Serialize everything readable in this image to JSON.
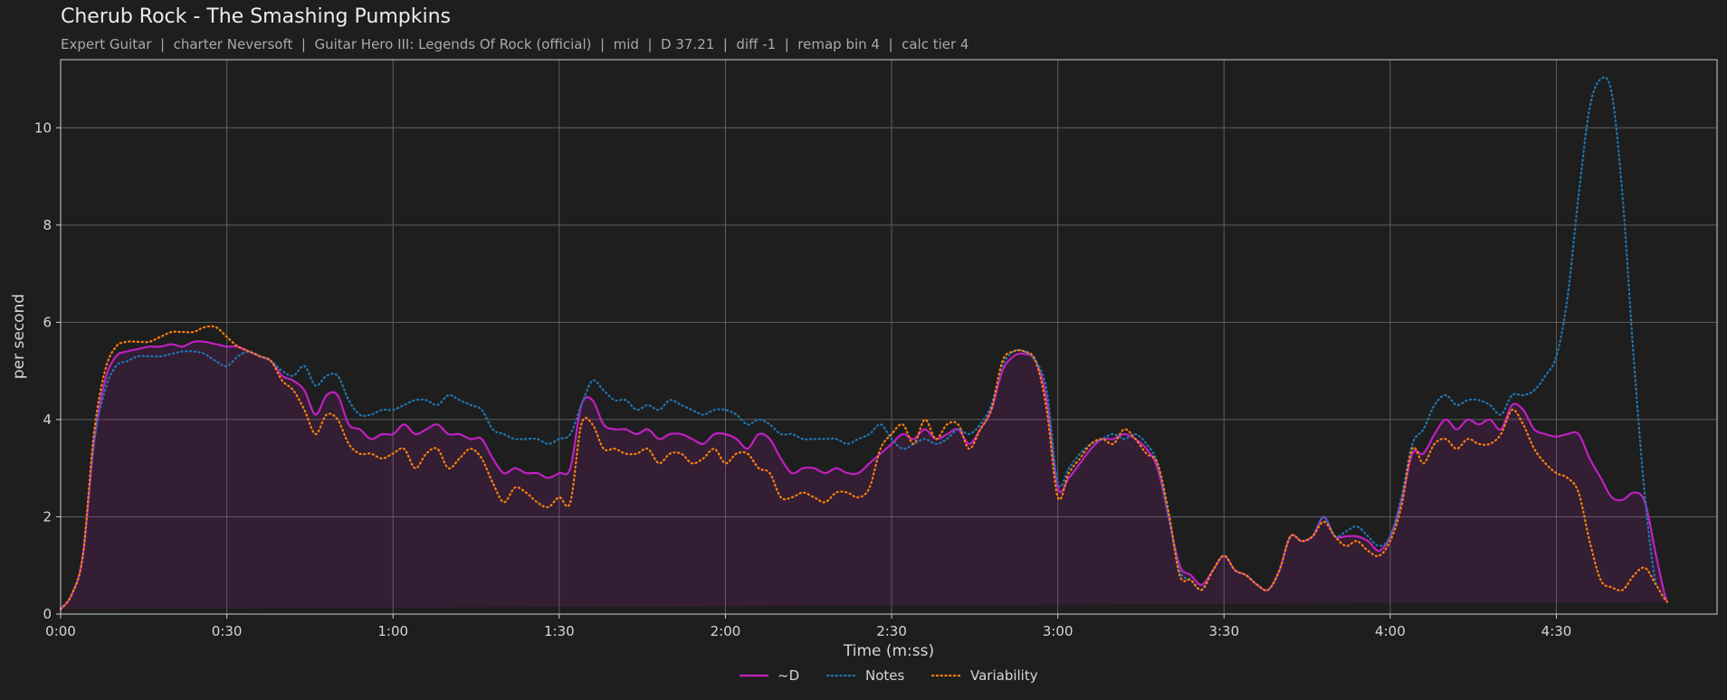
{
  "chart_data": {
    "type": "line",
    "title": "Cherub Rock - The Smashing Pumpkins",
    "subtitle": "Expert Guitar  |  charter Neversoft  |  Guitar Hero III: Legends Of Rock (official)  |  mid  |  D 37.21  |  diff -1  |  remap bin 4  |  calc tier 4",
    "xlabel": "Time (m:ss)",
    "ylabel": "per second",
    "x_unit": "seconds",
    "xlim": [
      0,
      299
    ],
    "ylim": [
      0,
      11.4
    ],
    "x_ticks": [
      0,
      30,
      60,
      90,
      120,
      150,
      180,
      210,
      240,
      270
    ],
    "x_tick_labels": [
      "0:00",
      "0:30",
      "1:00",
      "1:30",
      "2:00",
      "2:30",
      "3:00",
      "3:30",
      "4:00",
      "4:30"
    ],
    "y_ticks": [
      0,
      2,
      4,
      6,
      8,
      10
    ],
    "y_tick_labels": [
      "0",
      "2",
      "4",
      "6",
      "8",
      "10"
    ],
    "grid": true,
    "legend_position": "bottom-center",
    "x": [
      0,
      2,
      4,
      6,
      8,
      10,
      12,
      14,
      16,
      18,
      20,
      22,
      24,
      26,
      28,
      30,
      32,
      34,
      36,
      38,
      40,
      42,
      44,
      46,
      48,
      50,
      52,
      54,
      56,
      58,
      60,
      62,
      64,
      66,
      68,
      70,
      72,
      74,
      76,
      78,
      80,
      82,
      84,
      86,
      88,
      90,
      92,
      94,
      96,
      98,
      100,
      102,
      104,
      106,
      108,
      110,
      112,
      114,
      116,
      118,
      120,
      122,
      124,
      126,
      128,
      130,
      132,
      134,
      136,
      138,
      140,
      142,
      144,
      146,
      148,
      150,
      152,
      154,
      156,
      158,
      160,
      162,
      164,
      166,
      168,
      170,
      172,
      174,
      176,
      178,
      180,
      182,
      184,
      186,
      188,
      190,
      192,
      194,
      196,
      198,
      200,
      202,
      204,
      206,
      208,
      210,
      212,
      214,
      216,
      218,
      220,
      222,
      224,
      226,
      228,
      230,
      232,
      234,
      236,
      238,
      240,
      242,
      244,
      246,
      248,
      250,
      252,
      254,
      256,
      258,
      260,
      262,
      264,
      266,
      268,
      270,
      272,
      274,
      276,
      278,
      280,
      282,
      284,
      286,
      288,
      290,
      292,
      294,
      296,
      298,
      299
    ],
    "series": [
      {
        "name": "~D",
        "color": "#c020c0",
        "style": "solid",
        "filled": true,
        "values": [
          0.1,
          0.4,
          1.2,
          3.5,
          4.8,
          5.3,
          5.4,
          5.45,
          5.5,
          5.5,
          5.55,
          5.5,
          5.6,
          5.6,
          5.55,
          5.5,
          5.5,
          5.4,
          5.3,
          5.2,
          4.9,
          4.8,
          4.6,
          4.1,
          4.5,
          4.5,
          3.9,
          3.8,
          3.6,
          3.7,
          3.7,
          3.9,
          3.7,
          3.8,
          3.9,
          3.7,
          3.7,
          3.6,
          3.6,
          3.2,
          2.9,
          3.0,
          2.9,
          2.9,
          2.8,
          2.9,
          3.0,
          4.3,
          4.4,
          3.9,
          3.8,
          3.8,
          3.7,
          3.8,
          3.6,
          3.7,
          3.7,
          3.6,
          3.5,
          3.7,
          3.7,
          3.6,
          3.4,
          3.7,
          3.6,
          3.2,
          2.9,
          3.0,
          3.0,
          2.9,
          3.0,
          2.9,
          2.9,
          3.1,
          3.3,
          3.5,
          3.7,
          3.6,
          3.8,
          3.6,
          3.7,
          3.8,
          3.5,
          3.8,
          4.2,
          5.0,
          5.3,
          5.35,
          5.2,
          4.4,
          2.6,
          2.8,
          3.1,
          3.4,
          3.6,
          3.6,
          3.7,
          3.6,
          3.4,
          3.0,
          2.0,
          1.0,
          0.8,
          0.6,
          0.9,
          1.2,
          0.9,
          0.8,
          0.6,
          0.5,
          0.9,
          1.6,
          1.5,
          1.6,
          2.0,
          1.6,
          1.6,
          1.6,
          1.5,
          1.3,
          1.6,
          2.3,
          3.3,
          3.3,
          3.7,
          4.0,
          3.8,
          4.0,
          3.9,
          4.0,
          3.8,
          4.3,
          4.2,
          3.8,
          3.7,
          3.65,
          3.7,
          3.7,
          3.2,
          2.8,
          2.4,
          2.35,
          2.5,
          2.3,
          1.2,
          0.25,
          0.15
        ]
      },
      {
        "name": "Notes",
        "color": "#1f77b4",
        "style": "dotted",
        "filled": false,
        "values": [
          0.1,
          0.4,
          1.2,
          3.5,
          4.6,
          5.1,
          5.2,
          5.3,
          5.3,
          5.3,
          5.35,
          5.4,
          5.4,
          5.35,
          5.2,
          5.1,
          5.3,
          5.4,
          5.3,
          5.2,
          5.0,
          4.9,
          5.1,
          4.7,
          4.9,
          4.9,
          4.4,
          4.1,
          4.1,
          4.2,
          4.2,
          4.3,
          4.4,
          4.4,
          4.3,
          4.5,
          4.4,
          4.3,
          4.2,
          3.8,
          3.7,
          3.6,
          3.6,
          3.6,
          3.5,
          3.6,
          3.7,
          4.3,
          4.8,
          4.6,
          4.4,
          4.4,
          4.2,
          4.3,
          4.2,
          4.4,
          4.3,
          4.2,
          4.1,
          4.2,
          4.2,
          4.1,
          3.9,
          4.0,
          3.9,
          3.7,
          3.7,
          3.6,
          3.6,
          3.6,
          3.6,
          3.5,
          3.6,
          3.7,
          3.9,
          3.6,
          3.4,
          3.5,
          3.6,
          3.5,
          3.6,
          3.8,
          3.7,
          3.9,
          4.3,
          5.1,
          5.4,
          5.4,
          5.2,
          4.6,
          2.7,
          3.0,
          3.3,
          3.5,
          3.6,
          3.7,
          3.6,
          3.7,
          3.5,
          3.1,
          2.0,
          0.9,
          0.7,
          0.5,
          0.9,
          1.2,
          0.9,
          0.8,
          0.6,
          0.5,
          0.9,
          1.6,
          1.5,
          1.6,
          2.0,
          1.6,
          1.7,
          1.8,
          1.6,
          1.4,
          1.6,
          2.4,
          3.5,
          3.8,
          4.3,
          4.5,
          4.3,
          4.4,
          4.4,
          4.3,
          4.1,
          4.5,
          4.5,
          4.6,
          4.9,
          5.3,
          6.5,
          8.6,
          10.4,
          11.0,
          10.7,
          8.5,
          5.2,
          2.4,
          0.6,
          0.2
        ]
      },
      {
        "name": "Variability",
        "color": "#ff7f0e",
        "style": "dotted",
        "filled": false,
        "values": [
          0.1,
          0.4,
          1.2,
          3.7,
          5.0,
          5.5,
          5.6,
          5.6,
          5.6,
          5.7,
          5.8,
          5.8,
          5.8,
          5.9,
          5.9,
          5.7,
          5.5,
          5.4,
          5.3,
          5.2,
          4.8,
          4.6,
          4.2,
          3.7,
          4.1,
          4.0,
          3.5,
          3.3,
          3.3,
          3.2,
          3.3,
          3.4,
          3.0,
          3.3,
          3.4,
          3.0,
          3.2,
          3.4,
          3.2,
          2.7,
          2.3,
          2.6,
          2.5,
          2.3,
          2.2,
          2.4,
          2.3,
          3.9,
          3.9,
          3.4,
          3.4,
          3.3,
          3.3,
          3.4,
          3.1,
          3.3,
          3.3,
          3.1,
          3.2,
          3.4,
          3.1,
          3.3,
          3.3,
          3.0,
          2.9,
          2.4,
          2.4,
          2.5,
          2.4,
          2.3,
          2.5,
          2.5,
          2.4,
          2.6,
          3.4,
          3.7,
          3.9,
          3.5,
          4.0,
          3.6,
          3.9,
          3.9,
          3.4,
          3.8,
          4.2,
          5.2,
          5.4,
          5.4,
          5.2,
          4.2,
          2.4,
          2.9,
          3.2,
          3.5,
          3.6,
          3.5,
          3.8,
          3.6,
          3.3,
          3.1,
          2.1,
          0.8,
          0.7,
          0.5,
          0.9,
          1.2,
          0.9,
          0.8,
          0.6,
          0.5,
          0.9,
          1.6,
          1.5,
          1.6,
          1.9,
          1.6,
          1.4,
          1.5,
          1.3,
          1.2,
          1.5,
          2.2,
          3.4,
          3.1,
          3.5,
          3.6,
          3.4,
          3.6,
          3.5,
          3.5,
          3.7,
          4.2,
          3.9,
          3.4,
          3.1,
          2.9,
          2.8,
          2.5,
          1.5,
          0.7,
          0.55,
          0.5,
          0.8,
          0.95,
          0.6,
          0.25,
          0.15
        ]
      }
    ]
  }
}
